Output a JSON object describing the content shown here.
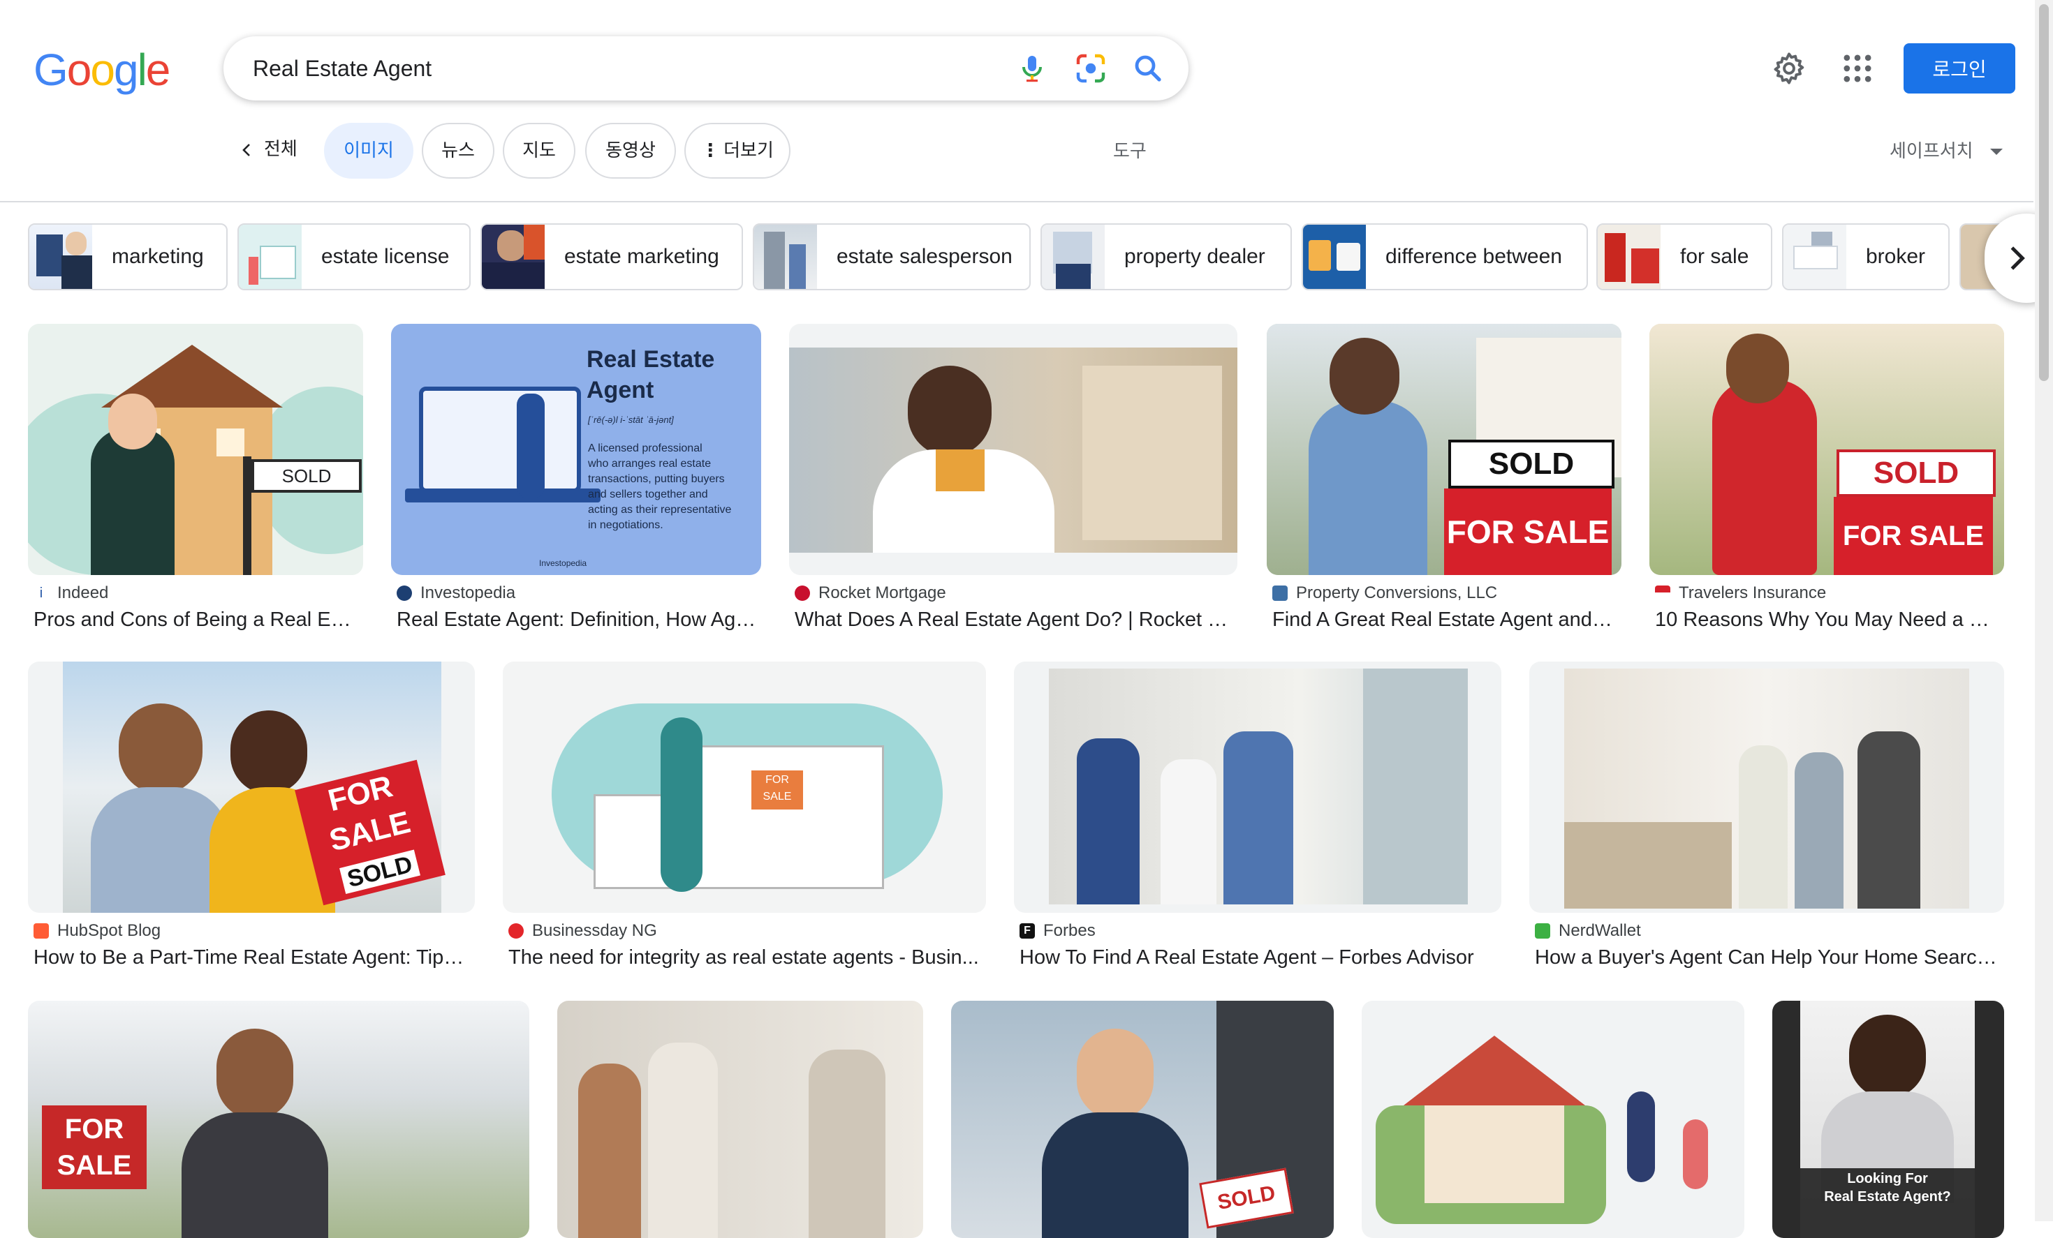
{
  "header": {
    "logo_letters": [
      "G",
      "o",
      "o",
      "g",
      "l",
      "e"
    ],
    "logo_colors": [
      "#4285f4",
      "#ea4335",
      "#fbbc05",
      "#4285f4",
      "#34a853",
      "#ea4335"
    ],
    "query": "Real Estate Agent",
    "login_label": "로그인",
    "icons": {
      "mic": "microphone-icon",
      "lens": "camera-lens-icon",
      "search": "search-icon",
      "settings": "gear-icon",
      "apps": "apps-grid-icon"
    }
  },
  "tabs": {
    "back_label": "전체",
    "items": [
      "이미지",
      "뉴스",
      "지도",
      "동영상",
      "더보기"
    ],
    "tools_label": "도구",
    "safesearch_label": "세이프서치"
  },
  "chips": [
    "marketing",
    "estate license",
    "estate marketing",
    "estate salesperson",
    "property dealer",
    "difference between",
    "for sale",
    "broker"
  ],
  "results": [
    {
      "source": "Indeed",
      "title": "Pros and Cons of Being a Real Est..."
    },
    {
      "source": "Investopedia",
      "title": "Real Estate Agent: Definition, How Age...",
      "img_text": [
        "Real Estate",
        "Agent",
        "[ˈrē(-ə)l i-ˈstāt ˈā-jənt]",
        "A licensed professional",
        "who arranges real estate",
        "transactions, putting buyers",
        "and sellers together and",
        "acting as their representative",
        "in negotiations.",
        "Investopedia"
      ]
    },
    {
      "source": "Rocket Mortgage",
      "title": "What Does A Real Estate Agent Do? | Rocket M..."
    },
    {
      "source": "Property Conversions, LLC",
      "title": "Find A Great Real Estate Agent and F..."
    },
    {
      "source": "Travelers Insurance",
      "title": "10 Reasons Why You May Need a Re..."
    },
    {
      "source": "HubSpot Blog",
      "title": "How to Be a Part-Time Real Estate Agent: Tips ..."
    },
    {
      "source": "Businessday NG",
      "title": "The need for integrity as real estate agents - Busin..."
    },
    {
      "source": "Forbes",
      "title": "How To Find A Real Estate Agent – Forbes Advisor"
    },
    {
      "source": "NerdWallet",
      "title": "How a Buyer's Agent Can Help Your Home Search ..."
    },
    {
      "source": "",
      "title": ""
    },
    {
      "source": "",
      "title": ""
    },
    {
      "source": "",
      "title": ""
    },
    {
      "source": "",
      "title": ""
    },
    {
      "source": "",
      "title": "",
      "img_text": [
        "Looking For",
        "Real Estate Agent?"
      ]
    }
  ],
  "sign_text": {
    "sold": "SOLD",
    "for_sale": "FOR SALE"
  },
  "colors": {
    "accent": "#1a73e8",
    "active_tab_bg": "#e8f0fe"
  }
}
